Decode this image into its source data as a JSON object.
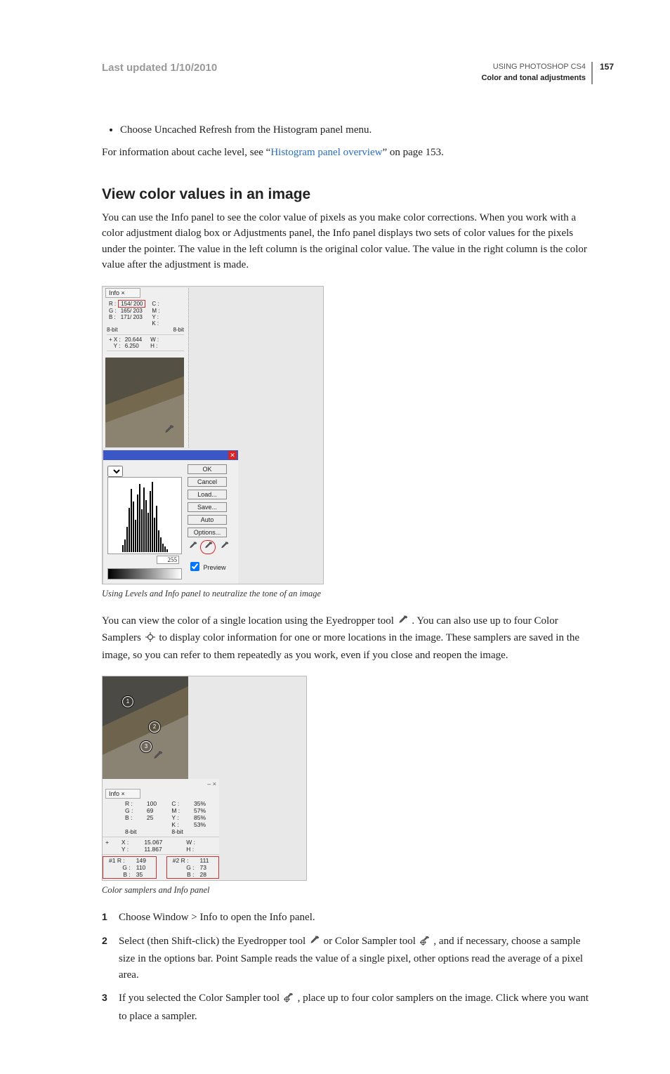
{
  "header": {
    "last_updated": "Last updated 1/10/2010",
    "chapter": "USING PHOTOSHOP CS4",
    "section": "Color and tonal adjustments",
    "page_num": "157"
  },
  "bullet1": "Choose Uncached Refresh from the Histogram panel menu.",
  "cache_line_pre": "For information about cache level, see “",
  "cache_link": "Histogram panel overview",
  "cache_line_post": "” on page 153.",
  "h2": "View color values in an image",
  "intro": "You can use the Info panel to see the color value of pixels as you make color corrections. When you work with a color adjustment dialog box or Adjustments panel, the Info panel displays two sets of color values for the pixels under the pointer. The value in the left column is the original color value. The value in the right column is the color value after the adjustment is made.",
  "fig1": {
    "info_tab": "Info ×",
    "rgb": {
      "R": "154/ 200",
      "G": "165/ 203",
      "B": "171/ 203"
    },
    "cmyk_labels": [
      "C :",
      "M :",
      "Y :",
      "K :"
    ],
    "bit": "8-bit",
    "xy": {
      "X": "20.644",
      "Y": "6.250"
    },
    "wh_labels": [
      "W :",
      "H :"
    ],
    "close_glyph": "✕",
    "num_255": "255",
    "buttons": [
      "OK",
      "Cancel",
      "Load...",
      "Save...",
      "Auto",
      "Options..."
    ],
    "preview": "Preview",
    "caption": "Using Levels and Info panel to neutralize the tone of an image"
  },
  "para2a": "You can view the color of a single location using the Eyedropper tool ",
  "para2b": ". You can also use up to four Color Samplers ",
  "para2c": " to display color information for one or more locations in the image. These samplers are saved in the image, so you can refer to them repeatedly as you work, even if you close and reopen the image.",
  "fig2": {
    "info_tab": "Info ×",
    "panel_ctrl": "– ×",
    "rgb": {
      "R": "100",
      "G": "69",
      "B": "25"
    },
    "cmyk": {
      "C": "35%",
      "M": "57%",
      "Y": "85%",
      "K": "53%"
    },
    "bit": "8-bit",
    "xy": {
      "X": "15.067",
      "Y": "11.867"
    },
    "wh_labels": [
      "W :",
      "H :"
    ],
    "s1": {
      "label": "#1 R :",
      "R": "149",
      "G": "110",
      "B": "35"
    },
    "s2": {
      "label": "#2 R :",
      "R": "111",
      "G": "73",
      "B": "28"
    },
    "caption": "Color samplers and Info panel"
  },
  "steps": {
    "s1": "Choose Window > Info to open the Info panel.",
    "s2a": "Select (then Shift-click) the Eyedropper tool ",
    "s2b": " or Color Sampler tool ",
    "s2c": ", and if necessary, choose a sample size in the options bar. Point Sample reads the value of a single pixel, other options read the average of a pixel area.",
    "s3a": "If you selected the Color Sampler tool ",
    "s3b": ", place up to four color samplers on the image. Click where you want to place a sampler."
  }
}
